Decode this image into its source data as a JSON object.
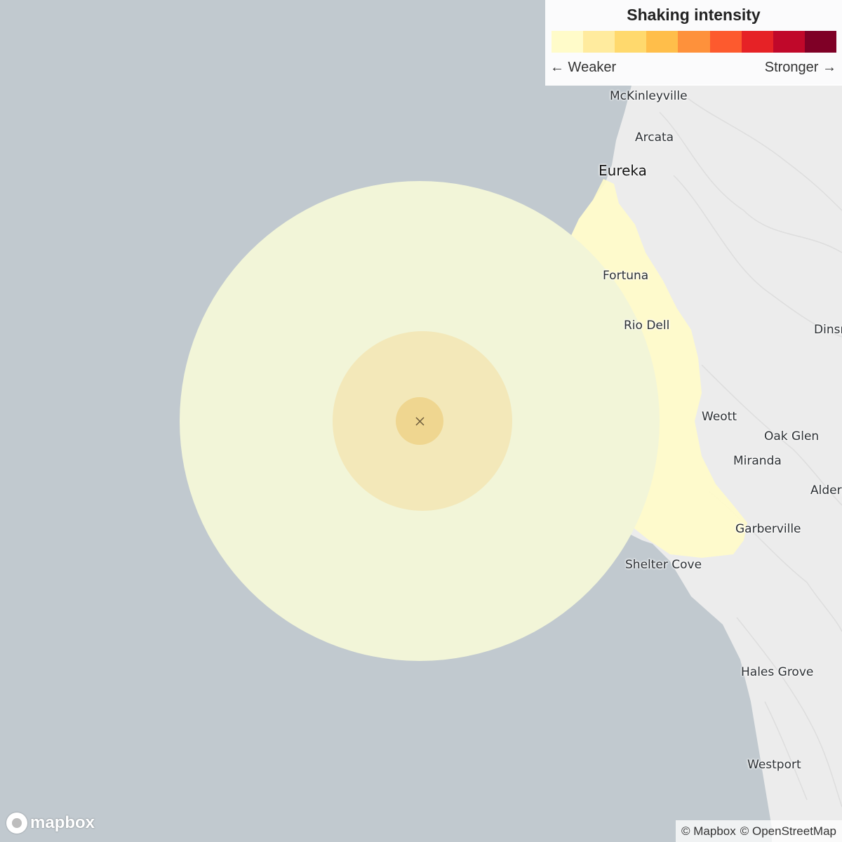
{
  "legend": {
    "title": "Shaking intensity",
    "weaker_label": "← Weaker",
    "stronger_label": "Stronger →",
    "colors": [
      "#fffbc9",
      "#ffeb9e",
      "#ffd96d",
      "#ffbe4a",
      "#fe913b",
      "#fd5a2e",
      "#e62226",
      "#c0082a",
      "#7f0026"
    ]
  },
  "places": [
    {
      "id": "mckinleyville",
      "label": "McKinleyville"
    },
    {
      "id": "arcata",
      "label": "Arcata"
    },
    {
      "id": "eureka",
      "label": "Eureka"
    },
    {
      "id": "fortuna",
      "label": "Fortuna"
    },
    {
      "id": "rio-dell",
      "label": "Rio Dell"
    },
    {
      "id": "dinsmore",
      "label": "Dinsm"
    },
    {
      "id": "weott",
      "label": "Weott"
    },
    {
      "id": "oak-glen",
      "label": "Oak Glen"
    },
    {
      "id": "miranda",
      "label": "Miranda"
    },
    {
      "id": "alderpoint",
      "label": "Alderp"
    },
    {
      "id": "garberville",
      "label": "Garberville"
    },
    {
      "id": "shelter-cove",
      "label": "Shelter Cove"
    },
    {
      "id": "hales-grove",
      "label": "Hales Grove"
    },
    {
      "id": "westport",
      "label": "Westport"
    }
  ],
  "map": {
    "water_color": "#c1c9cf",
    "land_color": "#ececec",
    "zone_colors": {
      "outer": "#f2f5d8",
      "land_tint": "#fffbc9",
      "middle": "#f3e8b9",
      "inner": "#efd690"
    },
    "epicenter_icon": "x-mark-icon"
  },
  "branding": {
    "logo_text": "mapbox",
    "attribution": [
      "© Mapbox",
      "© OpenStreetMap"
    ]
  }
}
